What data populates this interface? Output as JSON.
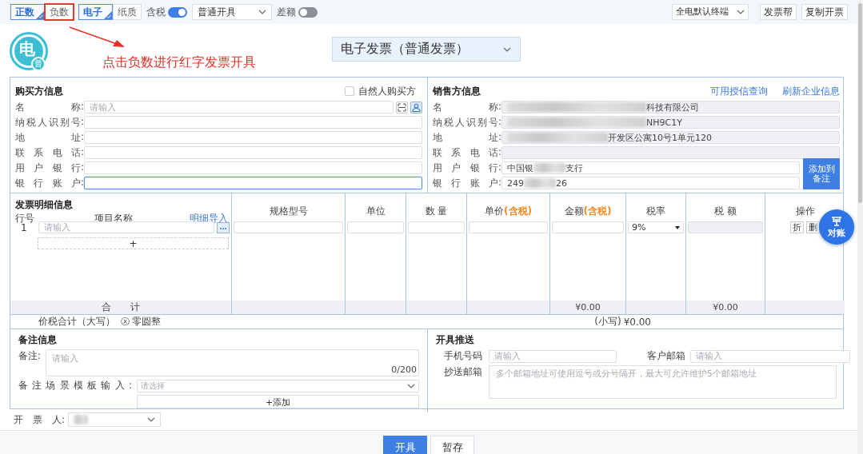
{
  "toolbar": {
    "direction_tabs": [
      {
        "label": "正数",
        "selected": true,
        "highlighted": false
      },
      {
        "label": "负数",
        "selected": false,
        "highlighted": true
      }
    ],
    "medium_tabs": [
      {
        "label": "电子",
        "selected": true
      },
      {
        "label": "纸质",
        "selected": false
      }
    ],
    "tax_included": {
      "label": "含税",
      "on": true
    },
    "issue_type": {
      "value": "普通开具"
    },
    "difference": {
      "label": "差额",
      "on": false
    },
    "terminal": {
      "value": "全电默认终端"
    },
    "buttons": [
      "发票帮",
      "复制开票"
    ]
  },
  "header": {
    "logo": {
      "main": "电",
      "badge": "普"
    },
    "annotation": "点击负数进行红字发票开具",
    "invoice_type": "电子发票（普通发票）"
  },
  "buyer": {
    "title": "购买方信息",
    "natural_person": {
      "label": "自然人购买方",
      "checked": false
    },
    "fields": [
      {
        "label": "名称:",
        "kind": "lookup",
        "placeholder": "请输入",
        "focused": false
      },
      {
        "label": "纳税人识别号:",
        "kind": "text",
        "focused": false
      },
      {
        "label": "地址:",
        "kind": "text",
        "focused": false
      },
      {
        "label": "联系电话:",
        "kind": "text",
        "focused": false
      },
      {
        "label": "用户银行:",
        "kind": "text",
        "focused": false
      },
      {
        "label": "银行账户:",
        "kind": "text",
        "focused": true
      }
    ]
  },
  "seller": {
    "title": "销售方信息",
    "links": [
      "可用授信查询",
      "刷新企业信息"
    ],
    "add_to_remarks": "添加到备注",
    "fields": [
      {
        "label": "名称:",
        "editable": false,
        "redacted": true,
        "text_after": "科技有限公司"
      },
      {
        "label": "纳税人识别号:",
        "editable": false,
        "redacted": true,
        "text_after": "NH9C1Y"
      },
      {
        "label": "地址:",
        "editable": false,
        "redacted": true,
        "text_after": "开发区公寓10号1单元120"
      },
      {
        "label": "联系电话:",
        "editable": false,
        "redacted": false
      },
      {
        "label": "用户银行:",
        "editable": true,
        "redacted": true,
        "text_before": "中国银",
        "text_after": "支行"
      },
      {
        "label": "银行账户:",
        "editable": true,
        "redacted": true,
        "text_before": "249",
        "text_after": "26"
      }
    ]
  },
  "details": {
    "title": "发票明细信息",
    "import_link": "明细导入",
    "columns": [
      {
        "label": "行号"
      },
      {
        "label": "项目名称"
      },
      {
        "label": "规格型号"
      },
      {
        "label": "单位"
      },
      {
        "label": "数 量"
      },
      {
        "label": "单价",
        "note": "(含税)"
      },
      {
        "label": "金额",
        "note": "(含税)"
      },
      {
        "label": "税率"
      },
      {
        "label": "税 额"
      },
      {
        "label": "操作"
      }
    ],
    "rows": [
      {
        "number": "1",
        "name_placeholder": "请输入",
        "tax_rate": "9%",
        "actions": [
          "折",
          "删"
        ]
      }
    ],
    "add_row": "+",
    "totals": {
      "label": "合　　计",
      "amount": "¥0.00",
      "tax": "¥0.00"
    },
    "summary": {
      "capital_label": "价税合计（大写）",
      "capital_icon": "ⓧ",
      "capital_value": "零圆整",
      "lower_label": "(小写)",
      "lower_value": "¥0.00"
    }
  },
  "float_button": {
    "label": "对账"
  },
  "remarks": {
    "title": "备注信息",
    "label": "备注:",
    "placeholder": "请输入",
    "counter": "0/200",
    "template_label": "备注场景模板输入:",
    "template_placeholder": "请选择",
    "add_button": "+添加"
  },
  "push": {
    "title": "开具推送",
    "phone": {
      "label": "手机号码",
      "placeholder": "请输入"
    },
    "email": {
      "label": "客户邮箱",
      "placeholder": "请输入"
    },
    "cc": {
      "label": "抄送邮箱",
      "placeholder": "多个邮箱地址可使用逗号或分号隔开，最大可允许维护5个邮箱地址"
    }
  },
  "issuer": {
    "label": "开　票　人:",
    "redacted": true
  },
  "footer_buttons": [
    {
      "label": "开具",
      "kind": "primary"
    },
    {
      "label": "暂存",
      "kind": "secondary"
    }
  ]
}
